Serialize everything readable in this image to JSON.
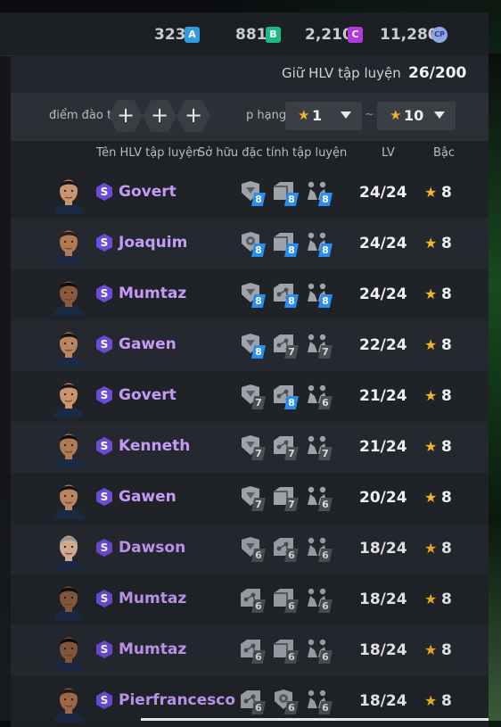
{
  "currencies": [
    {
      "value": "323",
      "badge": "A",
      "color": "#2f9be0"
    },
    {
      "value": "881",
      "badge": "B",
      "color": "#1db984"
    },
    {
      "value": "2,210",
      "badge": "C",
      "color": "#b03ae0"
    },
    {
      "value": "11,280",
      "badge": "CP",
      "color": "#8ea6e6"
    }
  ],
  "hold": {
    "label": "Giữ HLV tập luyện",
    "value": "26/200"
  },
  "filters": {
    "label": "điểm đào t",
    "plus": "+",
    "rank_label": "p hạng",
    "min_rank": "1",
    "max_rank": "10",
    "separator": "~"
  },
  "headers": {
    "name": "Tên HLV tập luyện",
    "traits": "Sở hữu đặc tính tập luyện",
    "lv": "LV",
    "rank": "Bậc"
  },
  "rows": [
    {
      "name": "Govert",
      "lv": "24/24",
      "rank": "8",
      "traits": [
        {
          "icon": "shield-icon",
          "level": "8",
          "hl": true
        },
        {
          "icon": "box-icon",
          "level": "8",
          "hl": true
        },
        {
          "icon": "players-icon",
          "level": "8",
          "hl": true
        }
      ]
    },
    {
      "name": "Joaquim",
      "lv": "24/24",
      "rank": "8",
      "traits": [
        {
          "icon": "ball-icon",
          "level": "8",
          "hl": true
        },
        {
          "icon": "box-icon",
          "level": "8",
          "hl": true
        },
        {
          "icon": "players-icon",
          "level": "8",
          "hl": true
        }
      ]
    },
    {
      "name": "Mumtaz",
      "lv": "24/24",
      "rank": "8",
      "traits": [
        {
          "icon": "shield-icon",
          "level": "8",
          "hl": true
        },
        {
          "icon": "nodes-icon",
          "level": "8",
          "hl": true
        },
        {
          "icon": "players-icon",
          "level": "8",
          "hl": true
        }
      ]
    },
    {
      "name": "Gawen",
      "lv": "22/24",
      "rank": "8",
      "traits": [
        {
          "icon": "shield-icon",
          "level": "8",
          "hl": true
        },
        {
          "icon": "nodes-icon",
          "level": "7",
          "hl": false
        },
        {
          "icon": "players-icon",
          "level": "7",
          "hl": false
        }
      ]
    },
    {
      "name": "Govert",
      "lv": "21/24",
      "rank": "8",
      "traits": [
        {
          "icon": "shield-icon",
          "level": "7",
          "hl": false
        },
        {
          "icon": "nodes-icon",
          "level": "8",
          "hl": true
        },
        {
          "icon": "players-icon",
          "level": "6",
          "hl": false
        }
      ]
    },
    {
      "name": "Kenneth",
      "lv": "21/24",
      "rank": "8",
      "traits": [
        {
          "icon": "shield-icon",
          "level": "7",
          "hl": false
        },
        {
          "icon": "nodes-icon",
          "level": "7",
          "hl": false
        },
        {
          "icon": "players-icon",
          "level": "7",
          "hl": false
        }
      ]
    },
    {
      "name": "Gawen",
      "lv": "20/24",
      "rank": "8",
      "traits": [
        {
          "icon": "shield-icon",
          "level": "7",
          "hl": false
        },
        {
          "icon": "box-icon",
          "level": "7",
          "hl": false
        },
        {
          "icon": "players-icon",
          "level": "6",
          "hl": false
        }
      ]
    },
    {
      "name": "Dawson",
      "lv": "18/24",
      "rank": "8",
      "traits": [
        {
          "icon": "shield-icon",
          "level": "6",
          "hl": false
        },
        {
          "icon": "nodes-icon",
          "level": "6",
          "hl": false
        },
        {
          "icon": "players-icon",
          "level": "6",
          "hl": false
        }
      ]
    },
    {
      "name": "Mumtaz",
      "lv": "18/24",
      "rank": "8",
      "traits": [
        {
          "icon": "nodes-icon",
          "level": "6",
          "hl": false
        },
        {
          "icon": "box-icon",
          "level": "6",
          "hl": false
        },
        {
          "icon": "players-icon",
          "level": "6",
          "hl": false
        }
      ]
    },
    {
      "name": "Mumtaz",
      "lv": "18/24",
      "rank": "8",
      "traits": [
        {
          "icon": "nodes-icon",
          "level": "6",
          "hl": false
        },
        {
          "icon": "box-icon",
          "level": "6",
          "hl": false
        },
        {
          "icon": "players-icon",
          "level": "6",
          "hl": false
        }
      ]
    },
    {
      "name": "Pierfrancesco",
      "lv": "18/24",
      "rank": "8",
      "traits": [
        {
          "icon": "nodes-icon",
          "level": "6",
          "hl": false
        },
        {
          "icon": "ball-icon",
          "level": "6",
          "hl": false
        },
        {
          "icon": "players-icon",
          "level": "6",
          "hl": false
        }
      ]
    }
  ],
  "row_badge": "S",
  "star_color": "#f2b324",
  "highlight_color": "#2a8df0",
  "name_color": "#c59bf7"
}
